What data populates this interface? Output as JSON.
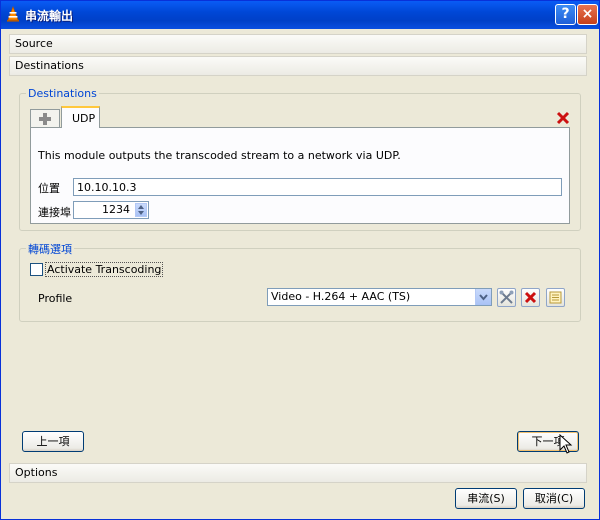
{
  "window": {
    "title": "串流輸出",
    "help_glyph": "?",
    "close_glyph": "×"
  },
  "sections": {
    "source": "Source",
    "destinations": "Destinations",
    "options": "Options"
  },
  "destinations_group": {
    "title": "Destinations",
    "tabs": [
      {
        "label": "+",
        "kind": "add"
      },
      {
        "label": "UDP",
        "selected": true
      }
    ],
    "description": "This module outputs the transcoded stream to a network via UDP.",
    "address_label": "位置",
    "address_value": "10.10.10.3",
    "port_label": "連接埠",
    "port_value": "1234"
  },
  "transcode_group": {
    "title": "轉碼選項",
    "activate_label": "Activate Transcoding",
    "activate_checked": false,
    "profile_label": "Profile",
    "profile_selected": "Video - H.264 + AAC (TS)",
    "profile_icons": [
      "edit-profile-icon",
      "delete-profile-icon",
      "new-profile-icon"
    ]
  },
  "nav": {
    "back": "上一項",
    "next": "下一項"
  },
  "footer": {
    "stream": "串流(S)",
    "cancel": "取消(C)"
  },
  "colors": {
    "title_bar": "#0047d6",
    "group_title": "#0046d5",
    "delete_red": "#cc1010"
  }
}
